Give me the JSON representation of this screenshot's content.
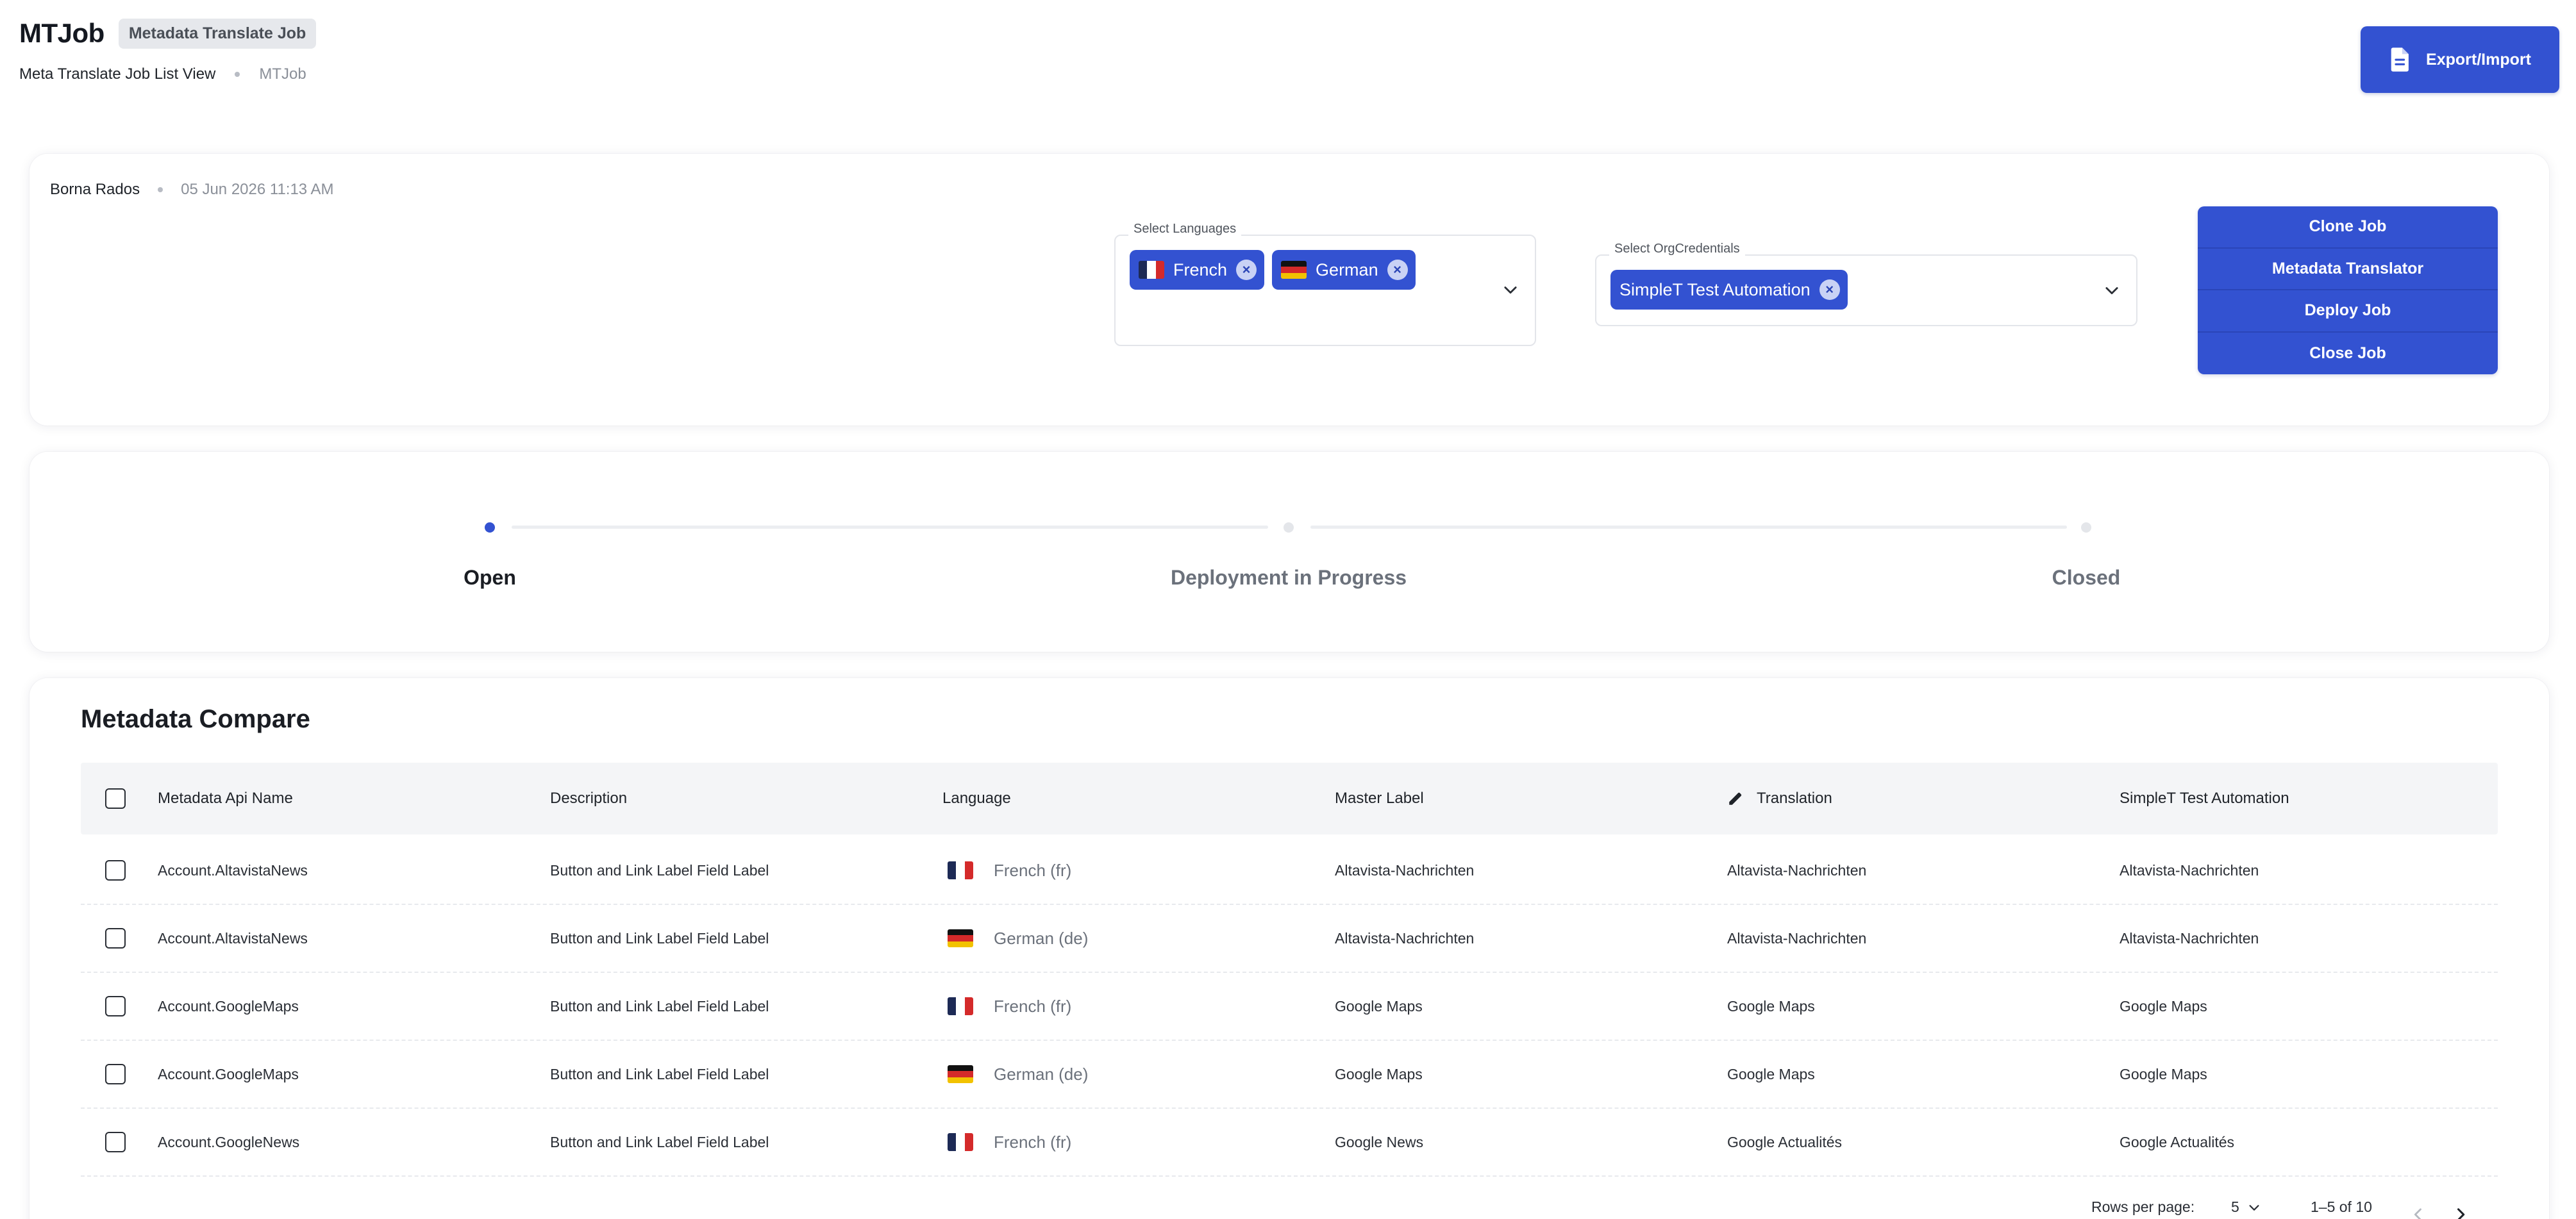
{
  "header": {
    "title": "MTJob",
    "chip": "Metadata Translate Job",
    "breadcrumb": [
      "Meta Translate Job List View",
      "MTJob"
    ],
    "export_label": "Export/Import"
  },
  "info": {
    "author": "Borna Rados",
    "date": "05 Jun 2026 11:13 AM",
    "languages": {
      "label": "Select Languages",
      "selected": [
        {
          "name": "French",
          "flag": "fr"
        },
        {
          "name": "German",
          "flag": "de"
        }
      ]
    },
    "org_credentials": {
      "label": "Select OrgCredentials",
      "selected": [
        "SimpleT Test Automation"
      ]
    },
    "actions": [
      "Clone Job",
      "Metadata Translator",
      "Deploy Job",
      "Close Job"
    ]
  },
  "stepper": {
    "steps": [
      "Open",
      "Deployment in Progress",
      "Closed"
    ],
    "active_index": 0
  },
  "table": {
    "title": "Metadata Compare",
    "columns": [
      "Metadata Api Name",
      "Description",
      "Language",
      "Master Label",
      "Translation",
      "SimpleT Test Automation"
    ],
    "rows": [
      {
        "api": "Account.AltavistaNews",
        "desc": "Button and Link Label Field Label",
        "lang": "French (fr)",
        "flag": "fr",
        "master": "Altavista-Nachrichten",
        "translation": "Altavista-Nachrichten",
        "org": "Altavista-Nachrichten"
      },
      {
        "api": "Account.AltavistaNews",
        "desc": "Button and Link Label Field Label",
        "lang": "German (de)",
        "flag": "de",
        "master": "Altavista-Nachrichten",
        "translation": "Altavista-Nachrichten",
        "org": "Altavista-Nachrichten"
      },
      {
        "api": "Account.GoogleMaps",
        "desc": "Button and Link Label Field Label",
        "lang": "French (fr)",
        "flag": "fr",
        "master": "Google Maps",
        "translation": "Google Maps",
        "org": "Google Maps"
      },
      {
        "api": "Account.GoogleMaps",
        "desc": "Button and Link Label Field Label",
        "lang": "German (de)",
        "flag": "de",
        "master": "Google Maps",
        "translation": "Google Maps",
        "org": "Google Maps"
      },
      {
        "api": "Account.GoogleNews",
        "desc": "Button and Link Label Field Label",
        "lang": "French (fr)",
        "flag": "fr",
        "master": "Google News",
        "translation": "Google Actualités",
        "org": "Google Actualités"
      }
    ],
    "pagination": {
      "rows_per_page_label": "Rows per page:",
      "rows_per_page": "5",
      "range": "1–5 of 10"
    }
  },
  "colors": {
    "accent": "#3352d1",
    "flag_fr": [
      "#1d2a55",
      "#ffffff",
      "#d42a2a"
    ],
    "flag_de": [
      "#111111",
      "#d42a2a",
      "#f2c200"
    ]
  }
}
